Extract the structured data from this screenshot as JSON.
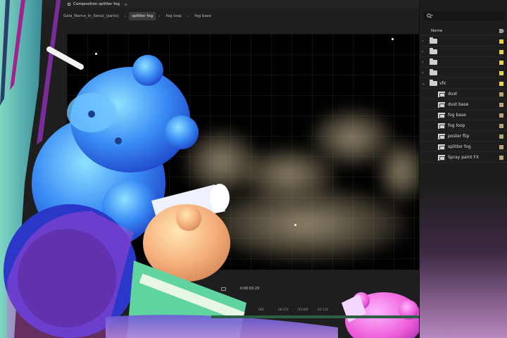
{
  "composition_panel": {
    "header_title": "Composition splitter fog",
    "breadcrumbs": [
      "Gala_Narna_In_Seoul_(parts)",
      "splitter fog",
      "fog loop",
      "fog base"
    ],
    "active_crumb_index": 1,
    "timecode": "0:00:02:23",
    "ruler_labels": [
      "00f",
      "00:15f",
      "01:00f",
      "01:15f"
    ]
  },
  "project_panel": {
    "column_name": "Name",
    "folder_color": "#e8d44a",
    "comp_color": "#b9a37a",
    "items": [
      {
        "type": "folder",
        "label": "",
        "expanded": false
      },
      {
        "type": "folder",
        "label": "",
        "expanded": false
      },
      {
        "type": "folder",
        "label": "",
        "expanded": false
      },
      {
        "type": "folder",
        "label": "",
        "expanded": false
      },
      {
        "type": "folder",
        "label": "vfx",
        "expanded": true
      },
      {
        "type": "comp",
        "label": "dust"
      },
      {
        "type": "comp",
        "label": "dust base"
      },
      {
        "type": "comp",
        "label": "fog base"
      },
      {
        "type": "comp",
        "label": "fog loop"
      },
      {
        "type": "comp",
        "label": "poster flip"
      },
      {
        "type": "comp",
        "label": "splitter fog"
      },
      {
        "type": "comp",
        "label": "Spray paint FX"
      }
    ]
  }
}
